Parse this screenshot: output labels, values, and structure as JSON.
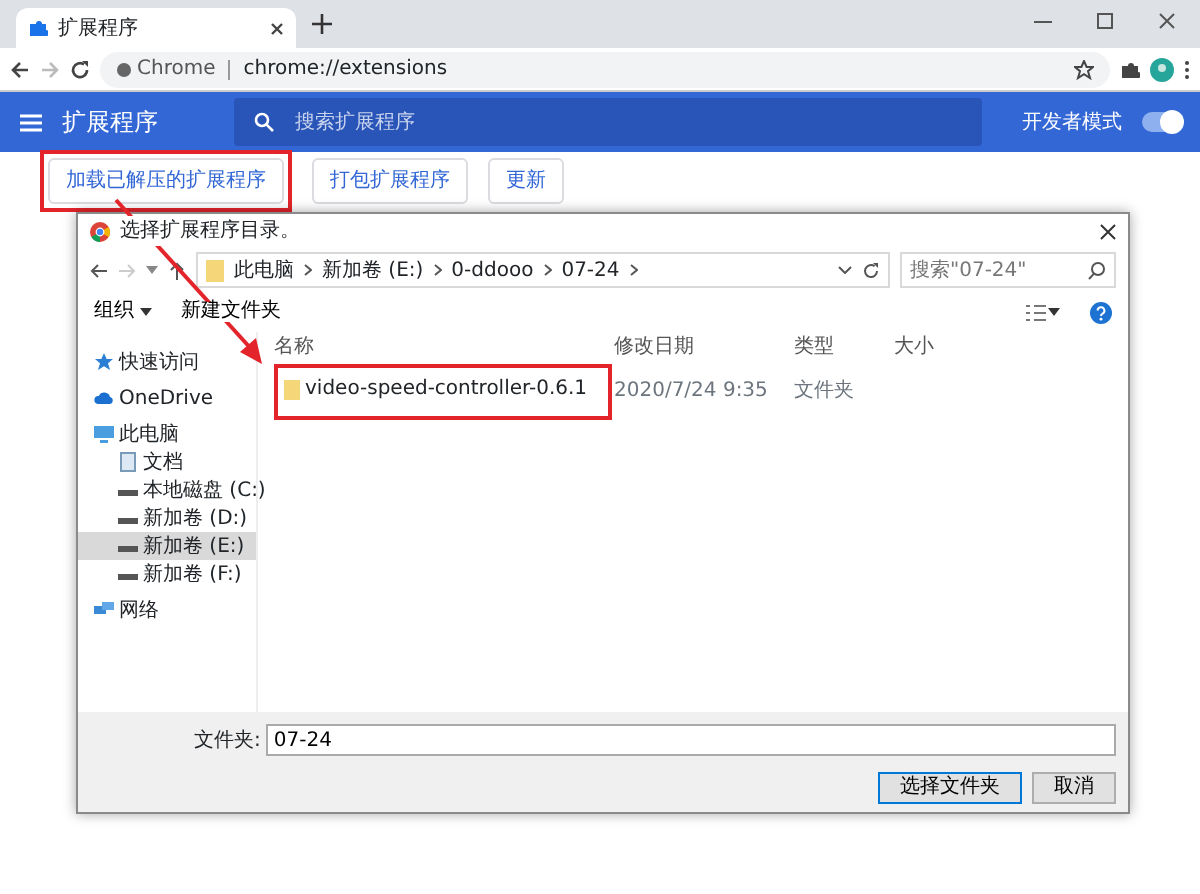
{
  "browser": {
    "tab_title": "扩展程序",
    "scheme_label": "Chrome",
    "url": "chrome://extensions"
  },
  "header": {
    "title": "扩展程序",
    "search_placeholder": "搜索扩展程序",
    "dev_mode_label": "开发者模式",
    "dev_mode_on": true
  },
  "toolbar_buttons": [
    {
      "label": "加载已解压的扩展程序",
      "annotated": true
    },
    {
      "label": "打包扩展程序",
      "annotated": false
    },
    {
      "label": "更新",
      "annotated": false
    }
  ],
  "dialog": {
    "title": "选择扩展程序目录。",
    "path": [
      "此电脑",
      "新加卷 (E:)",
      "0-ddooo",
      "07-24"
    ],
    "search_placeholder": "搜索\"07-24\"",
    "commands": [
      {
        "label": "组织",
        "dropdown": true
      },
      {
        "label": "新建文件夹",
        "dropdown": false
      }
    ],
    "sidebar": [
      {
        "label": "快速访问",
        "kind": "star",
        "selected": false
      },
      {
        "label": "OneDrive",
        "kind": "cloud",
        "selected": false
      },
      {
        "label": "此电脑",
        "kind": "pc",
        "selected": false,
        "children": [
          {
            "label": "文档",
            "kind": "doc",
            "selected": false
          },
          {
            "label": "本地磁盘 (C:)",
            "kind": "drive",
            "selected": false
          },
          {
            "label": "新加卷 (D:)",
            "kind": "drive",
            "selected": false
          },
          {
            "label": "新加卷 (E:)",
            "kind": "drive",
            "selected": true
          },
          {
            "label": "新加卷 (F:)",
            "kind": "drive",
            "selected": false
          }
        ]
      },
      {
        "label": "网络",
        "kind": "network",
        "selected": false
      }
    ],
    "columns": [
      "名称",
      "修改日期",
      "类型",
      "大小"
    ],
    "rows": [
      {
        "name": "video-speed-controller-0.6.1",
        "modified": "2020/7/24 9:35",
        "type": "文件夹",
        "annotated": true
      }
    ],
    "folder_label": "文件夹:",
    "folder_value": "07-24",
    "buttons": [
      {
        "label": "选择文件夹",
        "default": true
      },
      {
        "label": "取消",
        "default": false
      }
    ]
  }
}
